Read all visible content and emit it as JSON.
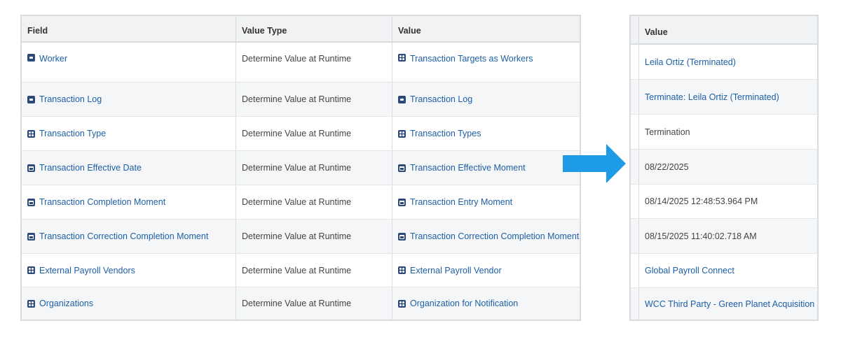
{
  "left_table": {
    "headers": {
      "field": "Field",
      "value_type": "Value Type",
      "value": "Value"
    },
    "rows": [
      {
        "field": "Worker",
        "field_icon": "instance-icon",
        "value_type": "Determine Value at Runtime",
        "value": "Transaction Targets as Workers",
        "value_icon": "multi-instance-icon"
      },
      {
        "field": "Transaction Log",
        "field_icon": "instance-icon",
        "value_type": "Determine Value at Runtime",
        "value": "Transaction Log",
        "value_icon": "instance-icon"
      },
      {
        "field": "Transaction Type",
        "field_icon": "multi-instance-icon",
        "value_type": "Determine Value at Runtime",
        "value": "Transaction Types",
        "value_icon": "multi-instance-icon"
      },
      {
        "field": "Transaction Effective Date",
        "field_icon": "date-icon",
        "value_type": "Determine Value at Runtime",
        "value": "Transaction Effective Moment",
        "value_icon": "date-icon"
      },
      {
        "field": "Transaction Completion Moment",
        "field_icon": "date-icon",
        "value_type": "Determine Value at Runtime",
        "value": "Transaction Entry Moment",
        "value_icon": "date-icon"
      },
      {
        "field": "Transaction Correction Completion Moment",
        "field_icon": "date-icon",
        "value_type": "Determine Value at Runtime",
        "value": "Transaction Correction Completion Moment",
        "value_icon": "date-icon"
      },
      {
        "field": "External Payroll Vendors",
        "field_icon": "multi-instance-icon",
        "value_type": "Determine Value at Runtime",
        "value": "External Payroll Vendor",
        "value_icon": "multi-instance-icon"
      },
      {
        "field": "Organizations",
        "field_icon": "multi-instance-icon",
        "value_type": "Determine Value at Runtime",
        "value": "Organization for Notification",
        "value_icon": "multi-instance-icon"
      }
    ]
  },
  "right_table": {
    "header": "Value",
    "rows": [
      {
        "value": "Leila Ortiz (Terminated)",
        "link": true
      },
      {
        "value": "Terminate: Leila Ortiz (Terminated)",
        "link": true
      },
      {
        "value": "Termination",
        "link": false
      },
      {
        "value": "08/22/2025",
        "link": false
      },
      {
        "value": "08/14/2025 12:48:53.964 PM",
        "link": false
      },
      {
        "value": "08/15/2025 11:40:02.718 AM",
        "link": false
      },
      {
        "value": "Global Payroll Connect",
        "link": true
      },
      {
        "value": "WCC Third Party - Green Planet Acquisition",
        "link": true
      }
    ]
  },
  "colors": {
    "link": "#1d5fa6",
    "arrow": "#1e9be6",
    "icon": "#2b4a79",
    "border": "#d9dcde",
    "header_bg": "#f1f2f3"
  },
  "arrow_icon": "right-arrow-icon"
}
